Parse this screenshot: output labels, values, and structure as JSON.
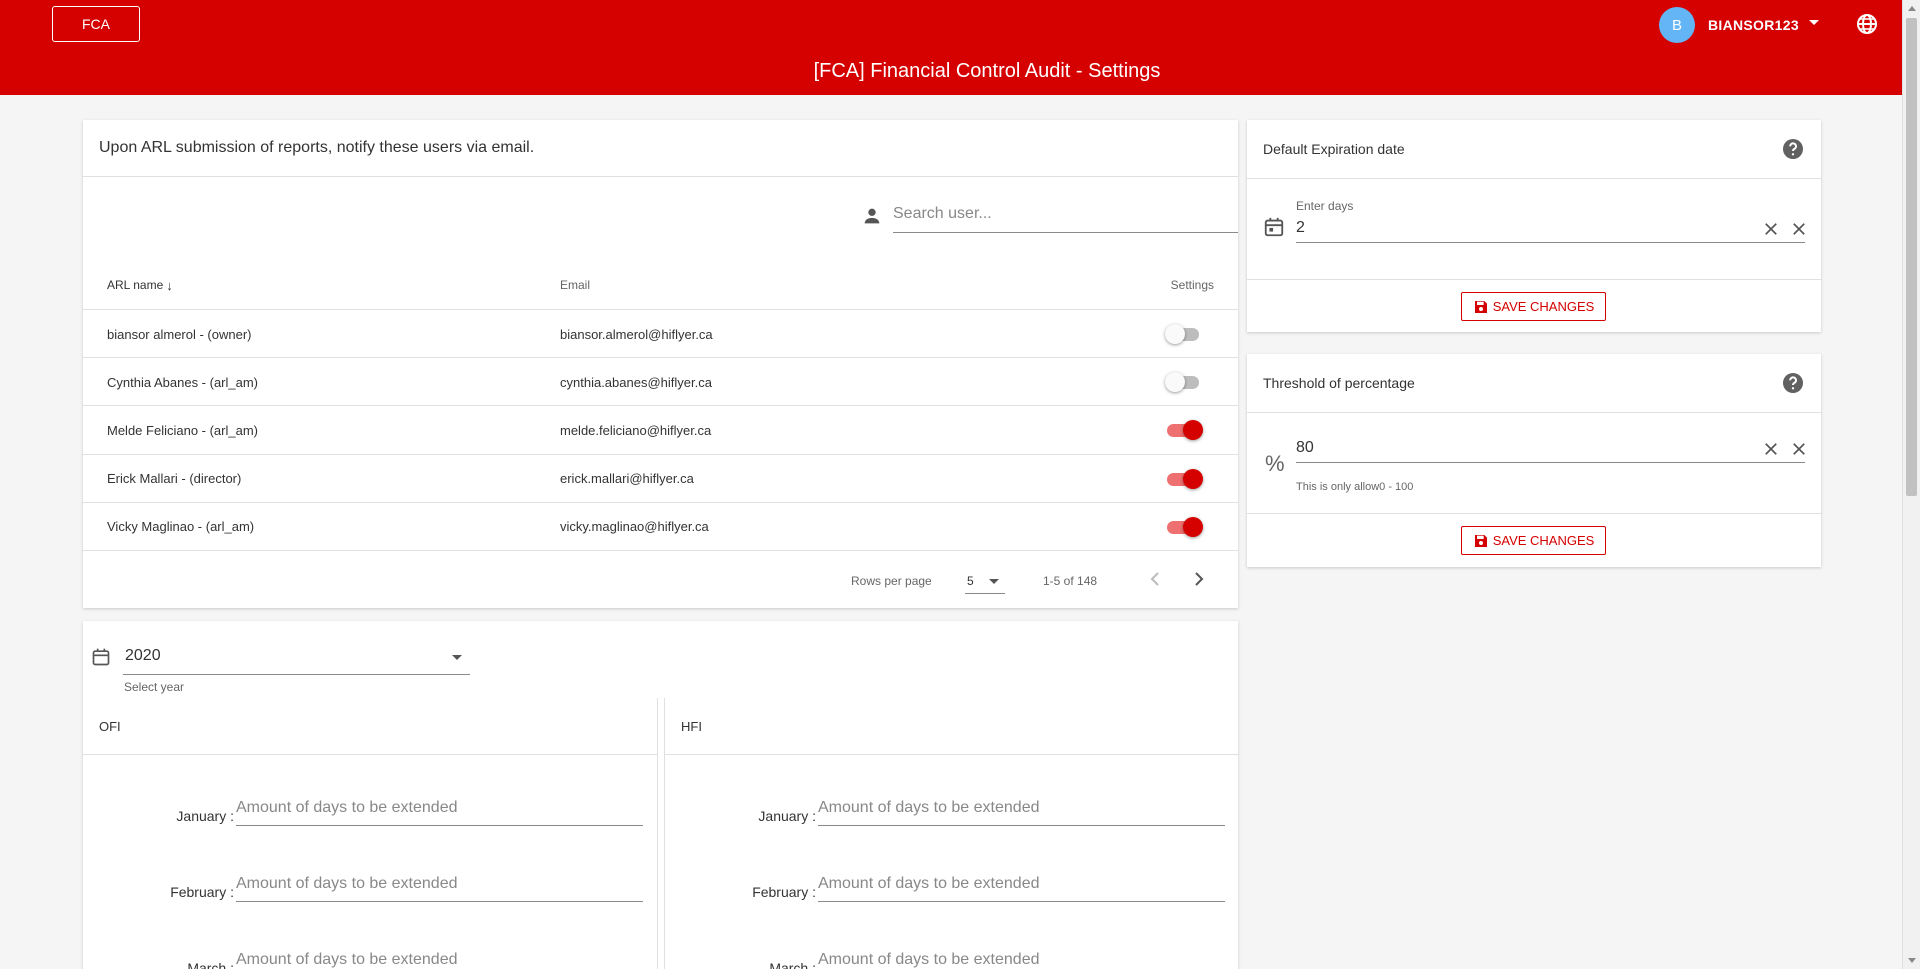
{
  "header": {
    "app_button": "FCA",
    "title": "[FCA] Financial Control Audit - Settings",
    "user_initial": "B",
    "username": "BIANSOR123",
    "brand_color": "#d50000"
  },
  "notify": {
    "heading": "Upon ARL submission of reports, notify these users via email.",
    "search_placeholder": "Search user...",
    "columns": {
      "name": "ARL name",
      "email": "Email",
      "settings": "Settings"
    },
    "rows": [
      {
        "name": "biansor almerol - (owner)",
        "email": "biansor.almerol@hiflyer.ca",
        "enabled": false
      },
      {
        "name": "Cynthia Abanes - (arl_am)",
        "email": "cynthia.abanes@hiflyer.ca",
        "enabled": false
      },
      {
        "name": "Melde Feliciano - (arl_am)",
        "email": "melde.feliciano@hiflyer.ca",
        "enabled": true
      },
      {
        "name": "Erick Mallari - (director)",
        "email": "erick.mallari@hiflyer.ca",
        "enabled": true
      },
      {
        "name": "Vicky Maglinao - (arl_am)",
        "email": "vicky.maglinao@hiflyer.ca",
        "enabled": true
      }
    ],
    "pager": {
      "rows_per_page_label": "Rows per page",
      "rows_per_page": "5",
      "range": "1-5 of 148"
    }
  },
  "year": {
    "value": "2020",
    "hint": "Select year",
    "ofi_label": "OFI",
    "hfi_label": "HFI",
    "month_placeholder": "Amount of days to be extended",
    "months": [
      "January :",
      "February :",
      "March :"
    ]
  },
  "expiration": {
    "title": "Default Expiration date",
    "label": "Enter days",
    "value": "2",
    "save_label": "SAVE CHANGES"
  },
  "threshold": {
    "title": "Threshold of percentage",
    "symbol": "%",
    "value": "80",
    "hint": "This is only allow0 - 100",
    "save_label": "SAVE CHANGES"
  }
}
